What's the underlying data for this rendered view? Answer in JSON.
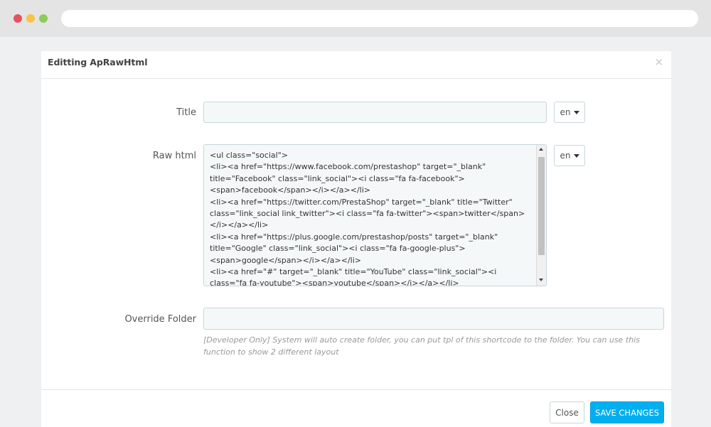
{
  "modal": {
    "title": "Editting ApRawHtml",
    "close_glyph": "×"
  },
  "form": {
    "title_label": "Title",
    "title_value": "",
    "title_lang": "en",
    "raw_label": "Raw html",
    "raw_lang": "en",
    "raw_value": "<ul class=\"social\">\n<li><a href=\"https://www.facebook.com/prestashop\" target=\"_blank\" title=\"Facebook\" class=\"link_social\"><i class=\"fa fa-facebook\"><span>facebook</span></i></a></li>\n<li><a href=\"https://twitter.com/PrestaShop\" target=\"_blank\" title=\"Twitter\" class=\"link_social link_twitter\"><i class=\"fa fa-twitter\"><span>twitter</span></i></a></li>\n<li><a href=\"https://plus.google.com/prestashop/posts\" target=\"_blank\" title=\"Google\" class=\"link_social\"><i class=\"fa fa-google-plus\"><span>google</span></i></a></li>\n<li><a href=\"#\" target=\"_blank\" title=\"YouTube\" class=\"link_social\"><i class=\"fa fa-youtube\"><span>youtube</span></i></a></li>",
    "override_label": "Override Folder",
    "override_value": "",
    "override_help": "[Developer Only] System will auto create folder, you can put tpl of this shortcode to the folder. You can use this function to show 2 different layout"
  },
  "footer": {
    "close_label": "Close",
    "save_label": "SAVE CHANGES"
  },
  "colors": {
    "primary": "#00aff0",
    "input_bg": "#f5f8f9",
    "input_border": "#c7d6db"
  }
}
